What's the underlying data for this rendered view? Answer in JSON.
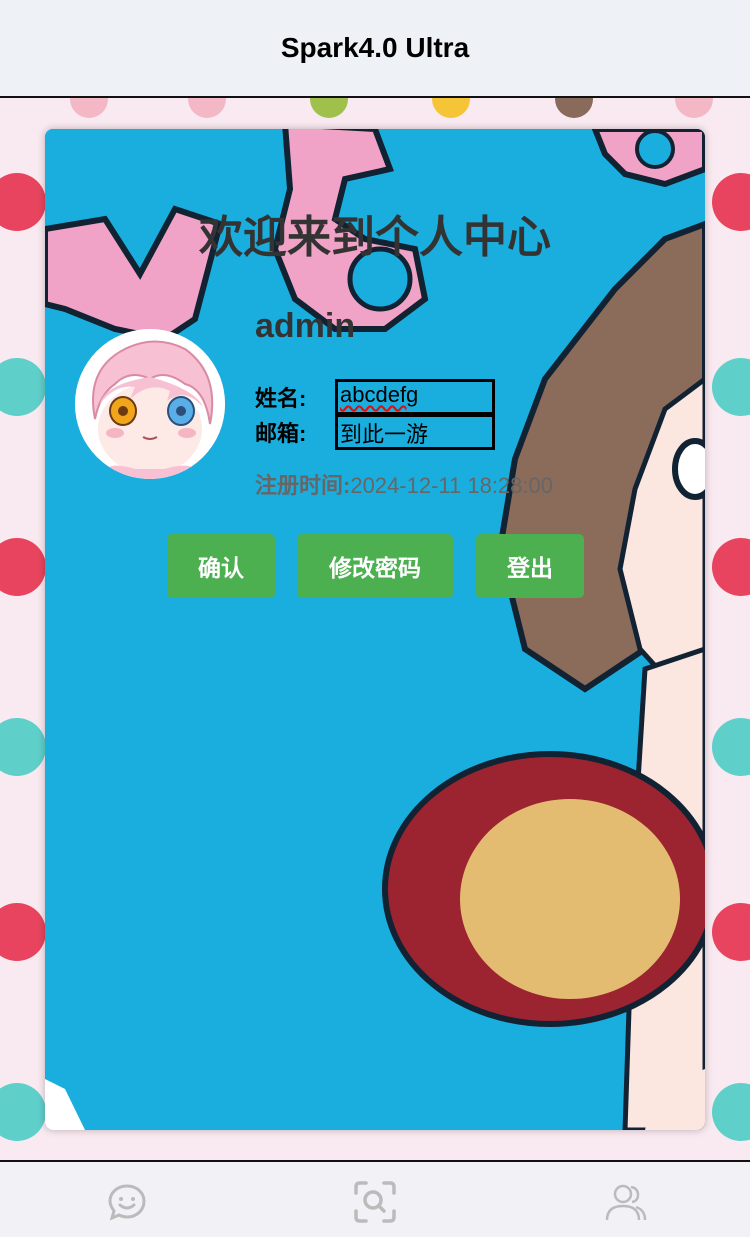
{
  "header": {
    "title": "Spark4.0 Ultra"
  },
  "profile": {
    "heading": "欢迎来到个人中心",
    "username": "admin",
    "name_label": "姓名:",
    "name_value": "abcdefg",
    "email_label": "邮箱:",
    "email_value": "到此一游",
    "reg_label": "注册时间:",
    "reg_value": "2024-12-11 18:28:00"
  },
  "actions": {
    "confirm": "确认",
    "change_password": "修改密码",
    "logout": "登出"
  },
  "bottom_nav": {
    "items": [
      {
        "icon": "chat-smile-icon"
      },
      {
        "icon": "scan-search-icon"
      },
      {
        "icon": "users-icon"
      }
    ]
  },
  "colors": {
    "button": "#4caf50",
    "card_bg": "#1aaedf",
    "page_bg": "#f9e9f0"
  }
}
